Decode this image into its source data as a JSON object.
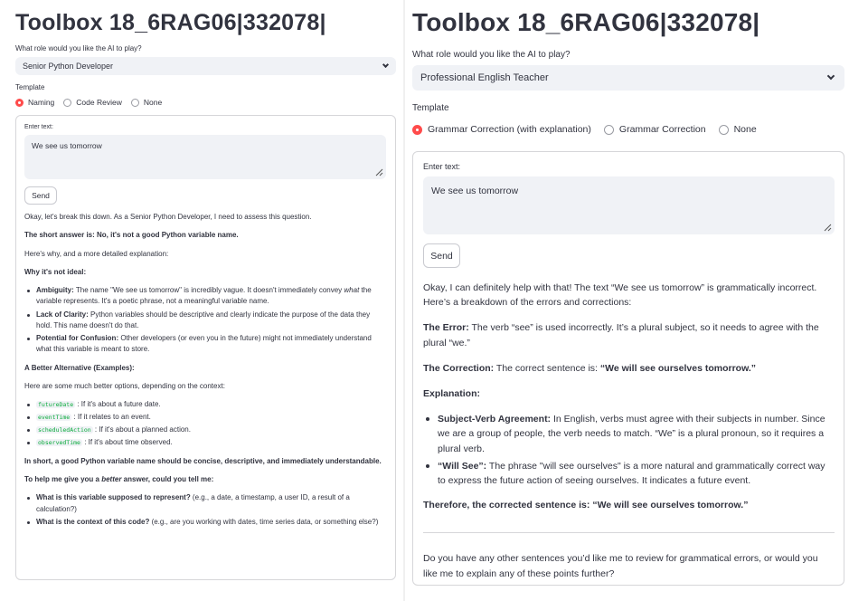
{
  "left": {
    "title": "Toolbox 18_6RAG06|332078|",
    "role_label": "What role would you like the AI to play?",
    "role_value": "Senior Python Developer",
    "template_label": "Template",
    "template_options": [
      "Naming",
      "Code Review",
      "None"
    ],
    "template_selected": "Naming",
    "input_label": "Enter text:",
    "input_value": "We see us tomorrow",
    "send_label": "Send",
    "response": {
      "intro": "Okay, let's break this down. As a Senior Python Developer, I need to assess this question.",
      "short_answer": "The short answer is: No, it's not a good Python variable name.",
      "detail_intro": "Here's why, and a more detailed explanation:",
      "why_heading": "Why it's not ideal:",
      "why_items": [
        {
          "term": "Ambiguity:",
          "text_a": " The name \"We see us tomorrow\" is incredibly vague. It doesn't immediately convey ",
          "em": "what",
          "text_b": " the variable represents. It's a poetic phrase, not a meaningful variable name."
        },
        {
          "term": "Lack of Clarity:",
          "text": " Python variables should be descriptive and clearly indicate the purpose of the data they hold. This name doesn't do that."
        },
        {
          "term": "Potential for Confusion:",
          "text": " Other developers (or even you in the future) might not immediately understand what this variable is meant to store."
        }
      ],
      "alt_heading": "A Better Alternative (Examples):",
      "alt_intro": "Here are some much better options, depending on the context:",
      "alt_items": [
        {
          "code": "futureDate",
          "text": " : If it's about a future date."
        },
        {
          "code": "eventTime",
          "text": " : If it relates to an event."
        },
        {
          "code": "scheduledAction",
          "text": " : If it's about a planned action."
        },
        {
          "code": "observedTime",
          "text": " : If it's about time observed."
        }
      ],
      "summary": "In short, a good Python variable name should be concise, descriptive, and immediately understandable.",
      "help_a": "To help me give you a ",
      "help_em": "better",
      "help_b": " answer, could you tell me:",
      "question_items": [
        {
          "term": "What is this variable supposed to represent?",
          "text": " (e.g., a date, a timestamp, a user ID, a result of a calculation?)"
        },
        {
          "term": "What is the context of this code?",
          "text": " (e.g., are you working with dates, time series data, or something else?)"
        }
      ]
    }
  },
  "right": {
    "title": "Toolbox 18_6RAG06|332078|",
    "role_label": "What role would you like the AI to play?",
    "role_value": "Professional English Teacher",
    "template_label": "Template",
    "template_options": [
      "Grammar Correction (with explanation)",
      "Grammar Correction",
      "None"
    ],
    "template_selected": "Grammar Correction (with explanation)",
    "input_label": "Enter text:",
    "input_value": "We see us tomorrow",
    "send_label": "Send",
    "response": {
      "intro": "Okay, I can definitely help with that! The text “We see us tomorrow” is grammatically incorrect. Here’s a breakdown of the errors and corrections:",
      "error_term": "The Error:",
      "error_text": " The verb “see” is used incorrectly. It’s a plural subject, so it needs to agree with the plural “we.”",
      "correction_term": "The Correction:",
      "correction_text": " The correct sentence is: ",
      "correction_bold": "“We will see ourselves tomorrow.”",
      "explanation_heading": "Explanation:",
      "items": [
        {
          "term": "Subject-Verb Agreement:",
          "text": " In English, verbs must agree with their subjects in number. Since we are a group of people, the verb needs to match. “We” is a plural pronoun, so it requires a plural verb."
        },
        {
          "term": "“Will See”:",
          "text": " The phrase \"will see ourselves\" is a more natural and grammatically correct way to express the future action of seeing ourselves. It indicates a future event."
        }
      ],
      "conclusion": "Therefore, the corrected sentence is: “We will see ourselves tomorrow.”",
      "followup": "Do you have any other sentences you’d like me to review for grammatical errors, or would you like me to explain any of these points further?"
    }
  }
}
